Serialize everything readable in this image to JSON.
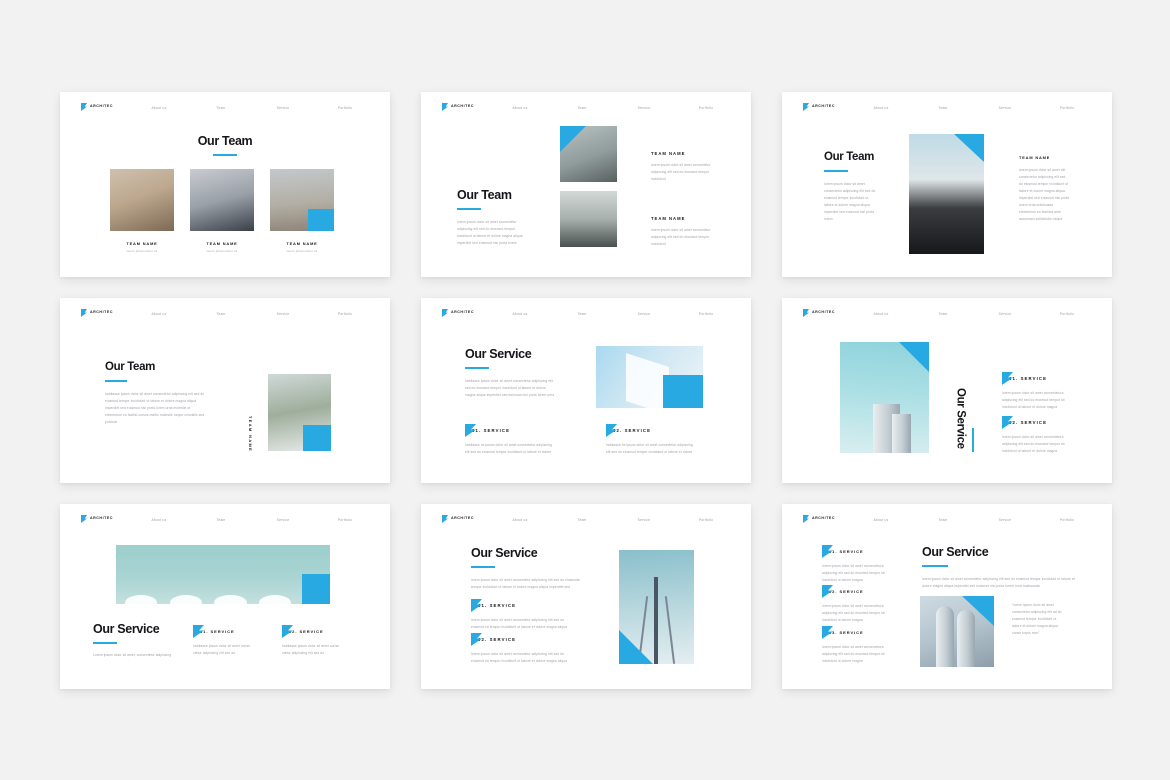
{
  "brand": {
    "name": "ARCHITEC",
    "accent": "#29a9e1",
    "logo_icon": "flag-mark-icon"
  },
  "nav": {
    "items": [
      "About us",
      "Team",
      "Service",
      "Portfolio"
    ]
  },
  "background": "#f2f2f2",
  "slides": [
    {
      "id": "team-grid",
      "title": "Our Team",
      "members": [
        {
          "name": "TEAM NAME",
          "role": "lorem ipsum dolor sit"
        },
        {
          "name": "TEAM NAME",
          "role": "lorem ipsum dolor sit"
        },
        {
          "name": "TEAM NAME",
          "role": "lorem ipsum dolor sit"
        }
      ]
    },
    {
      "id": "team-stacked",
      "title": "Our Team",
      "body": "lorem ipsum dolor sit amet consectetur adipiscing elit sed do eiusmod tempor incididunt ut labore et dolore magna aliqua imperdiet sed euismod nisi porta lorem",
      "members": [
        {
          "name": "TEAM NAME",
          "body": "lorem ipsum dolor sit amet consectetur adipiscing elit sed do eiusmod tempor incididunt"
        },
        {
          "name": "TEAM NAME",
          "body": "lorem ipsum dolor sit amet consectetur adipiscing elit sed do eiusmod tempor incididunt"
        }
      ]
    },
    {
      "id": "team-single",
      "title": "Our Team",
      "body": "lorem ipsum dolor sit amet consectetur adipiscing elit sed do eiusmod tempor incididunt ut labore et dolore magna aliqua imperdiet sed euismod nisi porta lorem",
      "member": {
        "name": "TEAM NAME",
        "body": "lorem ipsum dolor sit amet elit consectetur adipiscing elit sed do eiusmod tempor incididunt ut labore et dolore magna aliqua imperdiet sed euismod nisi porta lorem urna malesuada elementum eu facilisis ante accumsan sollicitudin neque"
      }
    },
    {
      "id": "team-vertical",
      "title": "Our Team",
      "body": "habitasse ipsum dolor sit amet consectetur adipiscing elit sed do eiusmod tempor incididunt ut labore et dolore magna aliqua imperdiet sed euismod nisi porta lorem urna molestie at elementum eu facilisi cursus mattis molestie neque convallis sed pulvinar",
      "member_label": "TEAM NAME"
    },
    {
      "id": "service-two-col",
      "title": "Our Service",
      "body": "habitasse ipsum dolor sit amet consectetur adipiscing elit sed do eiusmod tempor incididunt ut labore et dolore magna aliqua imperdiet sed euismod nisi porta lorem urna",
      "items": [
        {
          "label": "01. SERVICE",
          "body": "habitasse mi ipsum dolor sit amet consectetur adipiscing elit sed do eiusmod tempor incididunt ut labore et dolore"
        },
        {
          "label": "02. SERVICE",
          "body": "habitasse mi ipsum dolor sit amet consectetur adipiscing elit sed do eiusmod tempor incididunt ut labore et dolore"
        }
      ]
    },
    {
      "id": "service-vertical",
      "title": "Our Service",
      "items": [
        {
          "label": "01. SERVICE",
          "body": "lorem ipsum dolor sit amet consectetura adipiscing elit sed do eiusmod tempor sit incididunt ut labore et dolore magna"
        },
        {
          "label": "02. SERVICE",
          "body": "lorem ipsum dolor sit amet consectetura adipiscing elit sed do eiusmod tempor sit incididunt ut labore et dolore magna"
        }
      ]
    },
    {
      "id": "service-banner",
      "title": "Our Service",
      "body": "Lorem ipsum dolor sit amet, consectetur adipiscing",
      "items": [
        {
          "label": "01. SERVICE",
          "body": "habitasse ipsum dolor sit amet conse ctetur adipiscing elit sed do"
        },
        {
          "label": "02. SERVICE",
          "body": "habitasse ipsum dolor sit amet conse ctetur adipiscing elit sed do"
        }
      ]
    },
    {
      "id": "service-left-image-right",
      "title": "Our Service",
      "body": "lorem ipsum dolor sit amet consectetur adipiscing elit sed do eiusmode tempor incididunt ut labore et dolore magna aliqua imperdiet sed",
      "items": [
        {
          "label": "01. SERVICE",
          "body": "lorem ipsum dolor sit amet consectetur adipiscing elit sed do eiusmod ed tempor incididunt ut labore et dolore magna aliqua"
        },
        {
          "label": "02. SERVICE",
          "body": "lorem ipsum dolor sit amet consectetur adipiscing elit sed do eiusmod ed tempor incididunt ut labore et dolore magna aliqua"
        }
      ]
    },
    {
      "id": "service-three-items",
      "title": "Our Service",
      "body": "lorem ipsum dolor sit amet consectetur adipiscing elit sed do eiusmod tempor incididunt ut labore et dolore magna aliqua imperdiet sed euismod nisi porta lorem urna malesuada",
      "quote": "\"lorem ipsum dolor sit amet consectetur adipiscing elit ad do eiusmod tempor incididunt ut labore et dolore magna aliqua conse turpis mori\"",
      "items": [
        {
          "label": "01. SERVICE",
          "body": "lorem ipsum dolor sit amet consectetura adipiscing elit sed do eiusmod tempor sit incididunt ut dolore magna"
        },
        {
          "label": "02. SERVICE",
          "body": "lorem ipsum dolor sit amet consectetura adipiscing elit sed do eiusmod tempor sit incididunt ut dolore magna"
        },
        {
          "label": "03. SERVICE",
          "body": "lorem ipsum dolor sit amet consectetura adipiscing elit sed do eiusmod tempor sit incididunt ut dolore magna"
        }
      ]
    }
  ]
}
